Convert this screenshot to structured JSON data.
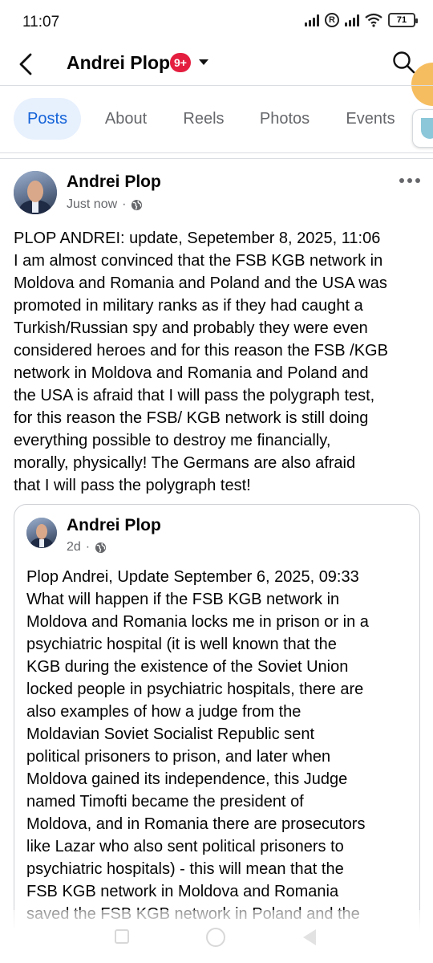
{
  "status_bar": {
    "time": "11:07",
    "battery": "71"
  },
  "header": {
    "title": "Andrei Plop",
    "notification_count": "9+",
    "icons": [
      "back-arrow-icon",
      "chevron-down-icon",
      "search-icon"
    ]
  },
  "tabs": [
    {
      "label": "Posts",
      "active": true
    },
    {
      "label": "About",
      "active": false
    },
    {
      "label": "Reels",
      "active": false
    },
    {
      "label": "Photos",
      "active": false
    },
    {
      "label": "Events",
      "active": false
    }
  ],
  "post": {
    "author": "Andrei Plop",
    "time": "Just now",
    "separator": "·",
    "lines": [
      "PLOP ANDREI: update, Sepetember 8, 2025, 11:06",
      "I am almost convinced that the FSB KGB network in",
      "Moldova and Romania and Poland and the USA was",
      "promoted in military ranks as if they had caught a",
      "Turkish/Russian spy and probably they were even",
      "considered heroes and for this reason the FSB /KGB",
      "network in Moldova and Romania and Poland and",
      "the USA is afraid that I will pass the polygraph test,",
      "for this reason the FSB/ KGB network is still doing",
      "everything possible to destroy me financially,",
      "morally, physically! The Germans are also afraid",
      "that I will pass the polygraph test!"
    ]
  },
  "shared_post": {
    "author": "Andrei Plop",
    "time": "2d",
    "separator": "·",
    "lines": [
      "Plop Andrei, Update September 6, 2025, 09:33",
      "What will happen if the FSB KGB network in",
      "Moldova and Romania locks me in prison or in a",
      "psychiatric hospital (it is well known that the",
      "KGB during the existence of the Soviet Union",
      "locked people in psychiatric hospitals, there are",
      "also examples of how a judge from the",
      "Moldavian Soviet Socialist Republic sent",
      "political prisoners to prison, and later when",
      "Moldova gained its independence, this Judge",
      "named Timofti became the president of",
      "Moldova, and in Romania there are prosecutors",
      "like Lazar who also sent political prisoners to",
      "psychiatric hospitals) - this will mean that the",
      "FSB KGB network in Moldova and Romania",
      "saved the FSB KGB network in Poland and the"
    ]
  },
  "colors": {
    "accent": "#1463d8",
    "tab_active_bg": "#e7f0fd",
    "badge": "#e41e3f",
    "secondary_text": "#65676b"
  }
}
